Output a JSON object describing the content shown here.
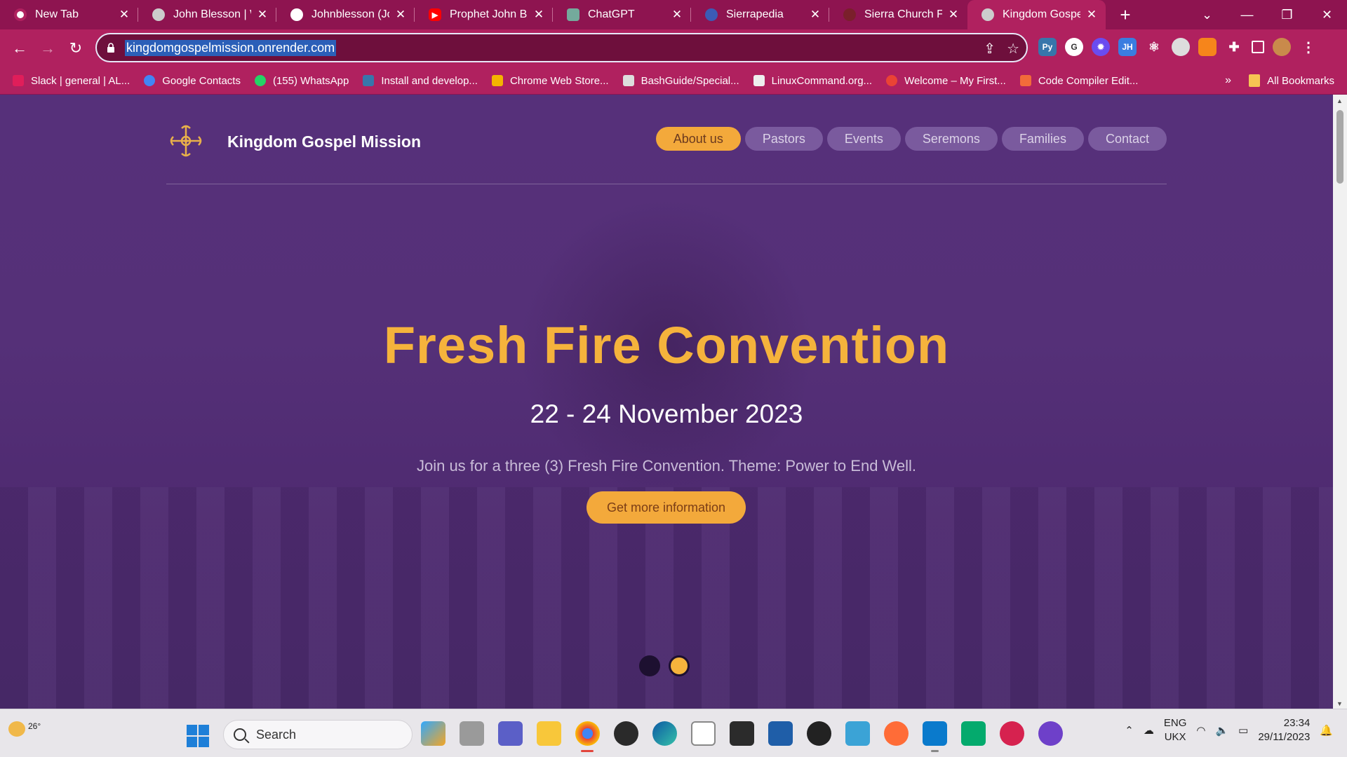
{
  "browser": {
    "tabs": [
      {
        "label": "New Tab",
        "icon": "chrome-icon",
        "color": "#ffffff"
      },
      {
        "label": "John Blesson | W",
        "icon": "globe-icon",
        "color": "#cccccc"
      },
      {
        "label": "Johnblesson (Joh",
        "icon": "github-icon",
        "color": "#ffffff"
      },
      {
        "label": "Prophet John Ble",
        "icon": "youtube-icon",
        "color": "#ff0000"
      },
      {
        "label": "ChatGPT",
        "icon": "chatgpt-icon",
        "color": "#74aa9c"
      },
      {
        "label": "Sierrapedia",
        "icon": "sierrapedia-icon",
        "color": "#3b5bb5"
      },
      {
        "label": "Sierra Church Fir",
        "icon": "search-icon",
        "color": "#7a1f2b"
      },
      {
        "label": "Kingdom Gospel",
        "icon": "globe-icon",
        "color": "#cccccc"
      }
    ],
    "new_tab": "+",
    "window_controls": [
      "⌄",
      "—",
      "❐",
      "✕"
    ],
    "url": "kingdomgospelmission.onrender.com",
    "bookmarks": [
      {
        "label": "Slack | general | AL...",
        "icon": "slack-icon",
        "color": "#e01e5a"
      },
      {
        "label": "Google Contacts",
        "icon": "contacts-icon",
        "color": "#4285f4"
      },
      {
        "label": "(155) WhatsApp",
        "icon": "whatsapp-icon",
        "color": "#25d366"
      },
      {
        "label": "Install and develop...",
        "icon": "python-icon",
        "color": "#3776ab"
      },
      {
        "label": "Chrome Web Store...",
        "icon": "webstore-icon",
        "color": "#f4b400"
      },
      {
        "label": "BashGuide/Special...",
        "icon": "bash-icon",
        "color": "#dddddd"
      },
      {
        "label": "LinuxCommand.org...",
        "icon": "linux-icon",
        "color": "#eeeeee"
      },
      {
        "label": "Welcome – My First...",
        "icon": "gcloud-icon",
        "color": "#ea4335"
      },
      {
        "label": "Code Compiler Edit...",
        "icon": "compiler-icon",
        "color": "#f26b3a"
      }
    ],
    "bookmarks_more": "»",
    "all_bookmarks": "All Bookmarks"
  },
  "site": {
    "brand": "Kingdom Gospel Mission",
    "nav": [
      "About us",
      "Pastors",
      "Events",
      "Seremons",
      "Families",
      "Contact"
    ],
    "active_nav_index": 0,
    "hero": {
      "title": "Fresh Fire Convention",
      "date": "22 - 24 November 2023",
      "text": "Join us for a three (3) Fresh Fire Convention. Theme: Power to End Well.",
      "cta": "Get more information"
    },
    "slides": 2,
    "active_slide": 2,
    "colors": {
      "accent": "#f5b33c",
      "background": "#56307a"
    }
  },
  "taskbar": {
    "weather": "26°",
    "search_placeholder": "Search",
    "language": [
      "ENG",
      "UKX"
    ],
    "time": "23:34",
    "date": "29/11/2023"
  }
}
